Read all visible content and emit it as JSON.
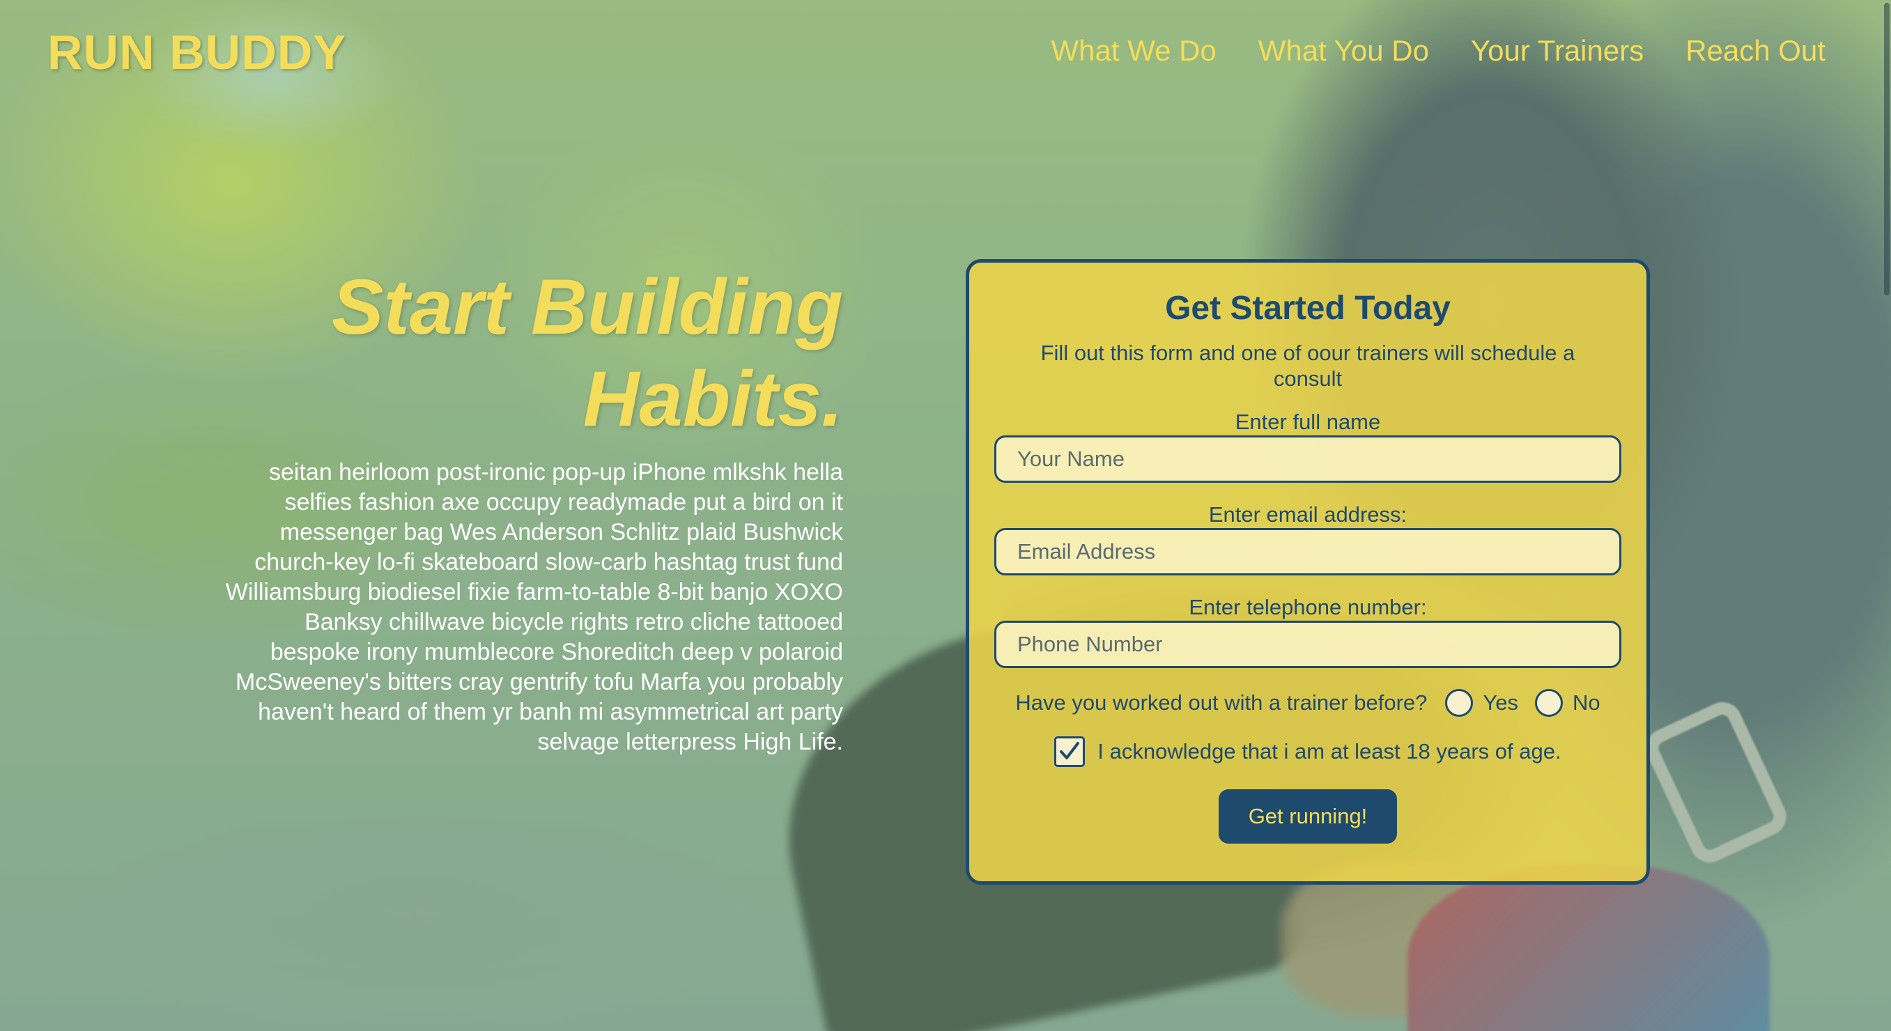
{
  "brand": {
    "logo_text": "RUN BUDDY"
  },
  "nav": {
    "items": [
      {
        "label": "What We Do"
      },
      {
        "label": "What You Do"
      },
      {
        "label": "Your Trainers"
      },
      {
        "label": "Reach Out"
      }
    ]
  },
  "hero": {
    "title_line1": "Start Building",
    "title_line2": "Habits.",
    "body": "seitan heirloom post-ironic pop-up iPhone mlkshk hella selfies fashion axe occupy readymade put a bird on it messenger bag Wes Anderson Schlitz plaid Bushwick church-key lo-fi skateboard slow-carb hashtag trust fund Williamsburg biodiesel fixie farm-to-table 8-bit banjo XOXO Banksy chillwave bicycle rights retro cliche tattooed bespoke irony mumblecore Shoreditch deep v polaroid McSweeney's bitters cray gentrify tofu Marfa you probably haven't heard of them yr banh mi asymmetrical art party selvage letterpress High Life."
  },
  "form": {
    "title": "Get Started Today",
    "subtitle": "Fill out this form and one of oour trainers will schedule a consult",
    "name": {
      "label": "Enter full name",
      "placeholder": "Your Name",
      "value": ""
    },
    "email": {
      "label": "Enter email address:",
      "placeholder": "Email Address",
      "value": ""
    },
    "phone": {
      "label": "Enter telephone number:",
      "placeholder": "Phone Number",
      "value": ""
    },
    "trainer_question": {
      "label": "Have you worked out with a trainer before?",
      "options": [
        "Yes",
        "No"
      ],
      "selected": null
    },
    "age_ack": {
      "label": "I acknowledge that i am at least 18 years of age.",
      "checked": true
    },
    "submit_label": "Get running!"
  },
  "colors": {
    "accent_yellow": "#f4dd5a",
    "navy": "#1e4a6e",
    "card_yellow": "#ecd44a"
  },
  "icons": {
    "checkbox_checked": "checkmark-icon"
  }
}
